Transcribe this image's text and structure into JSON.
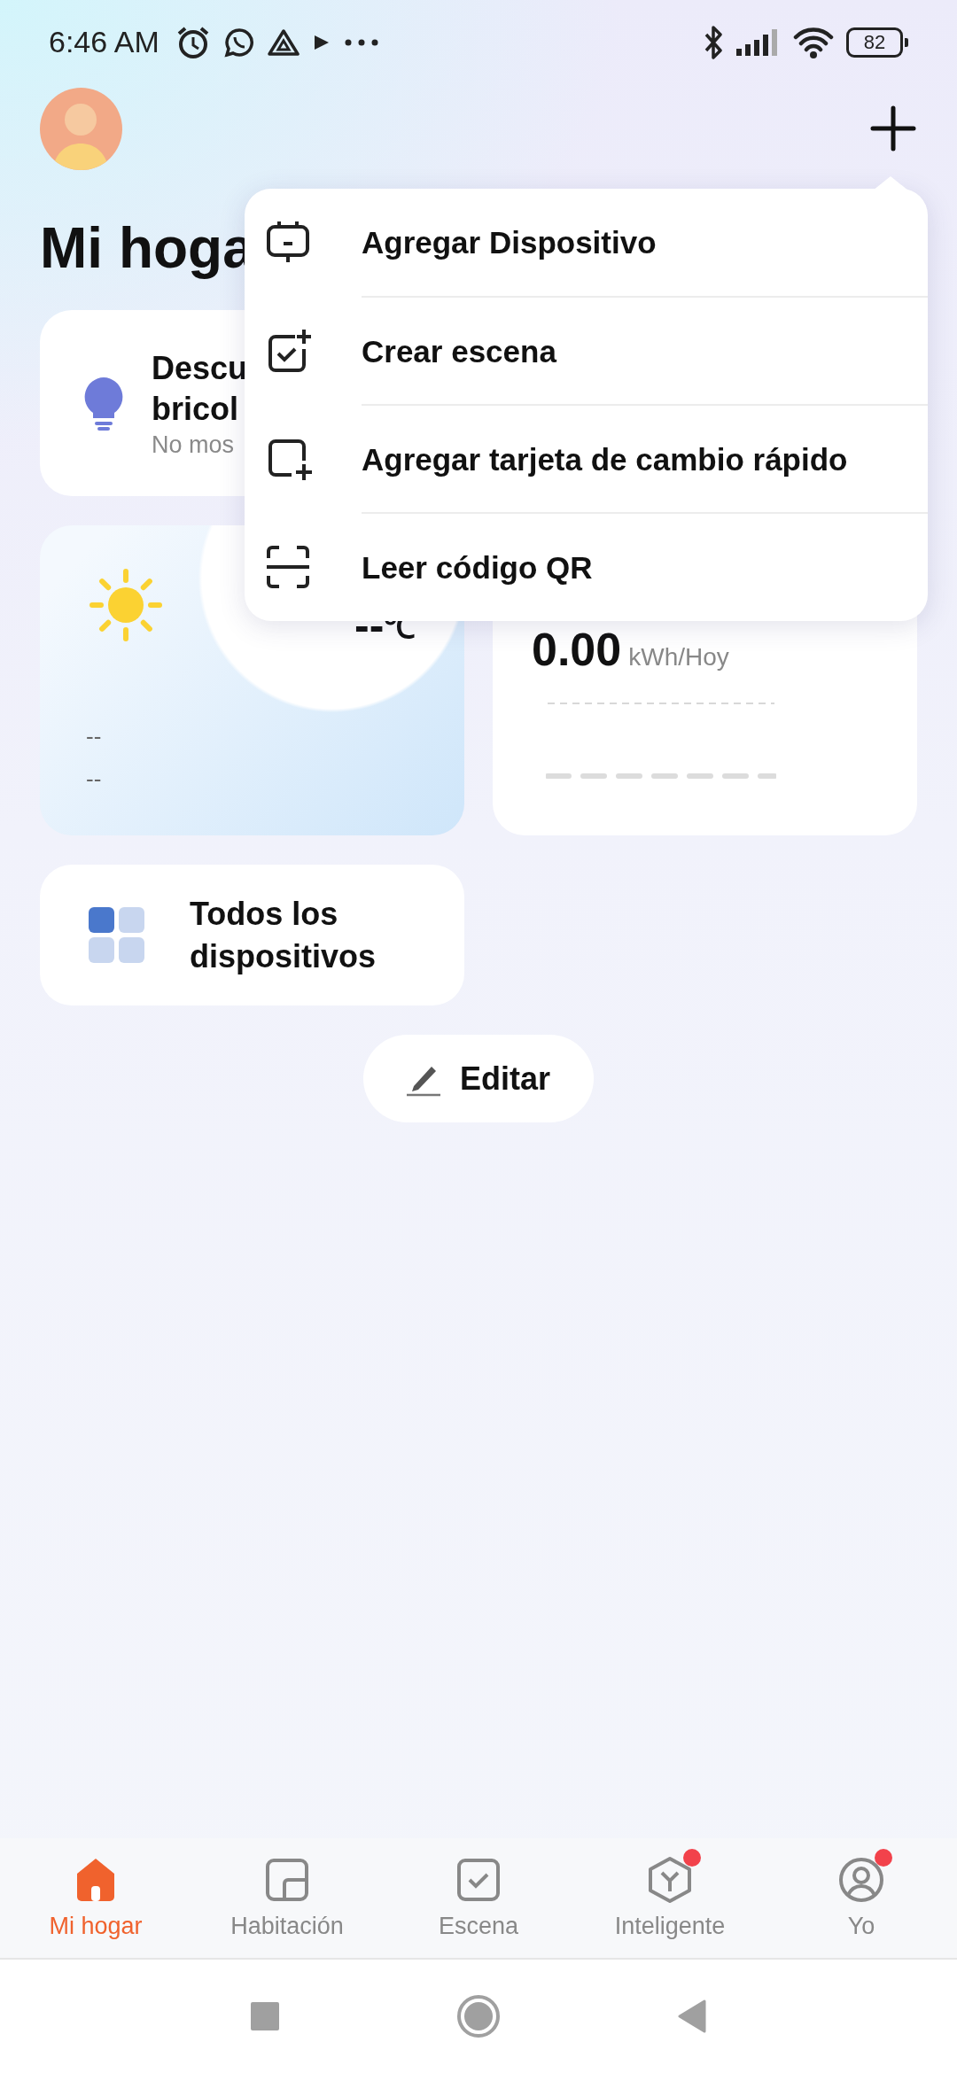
{
  "status_bar": {
    "time": "6:46 AM",
    "battery": "82"
  },
  "header": {
    "title": "Mi hoga"
  },
  "discover_card": {
    "title_lines": [
      "Descu",
      "bricol"
    ],
    "subtitle": "No mos"
  },
  "weather_card": {
    "temperature": "--",
    "unit": "℃",
    "lines": [
      "--",
      "--"
    ]
  },
  "energy_card": {
    "value": "0.00",
    "unit": "kWh/Hoy"
  },
  "devices_card": {
    "label": "Todos los dispositivos"
  },
  "edit_button": {
    "label": "Editar"
  },
  "menu": {
    "items": [
      {
        "kind": "device",
        "label": "Agregar Dispositivo"
      },
      {
        "kind": "scene",
        "label": "Crear escena"
      },
      {
        "kind": "card",
        "label": "Agregar tarjeta de cambio rápido"
      },
      {
        "kind": "qr",
        "label": "Leer código QR"
      }
    ]
  },
  "tabs": [
    {
      "kind": "home",
      "label": "Mi hogar",
      "selected": true,
      "notification": false
    },
    {
      "kind": "room",
      "label": "Habitación",
      "selected": false,
      "notification": false
    },
    {
      "kind": "scene",
      "label": "Escena",
      "selected": false,
      "notification": false
    },
    {
      "kind": "smart",
      "label": "Inteligente",
      "selected": false,
      "notification": true
    },
    {
      "kind": "me",
      "label": "Yo",
      "selected": false,
      "notification": true
    }
  ]
}
